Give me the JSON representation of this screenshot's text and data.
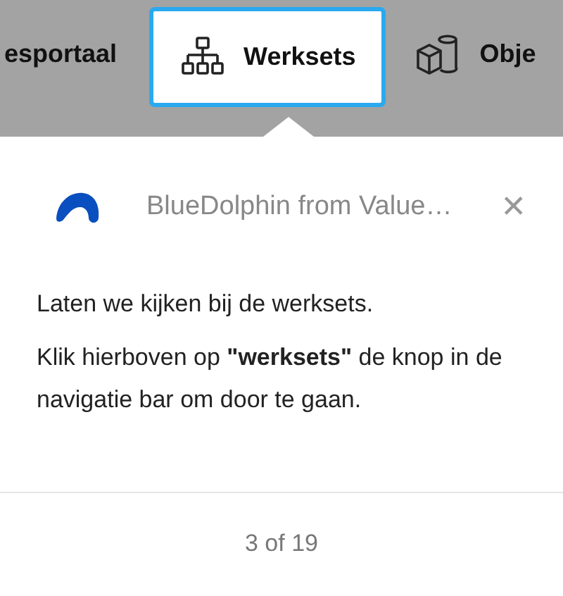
{
  "nav_items": [
    {
      "label": "esportaal",
      "selected": false
    },
    {
      "label": "Werksets",
      "selected": true
    },
    {
      "label": "Obje",
      "selected": false
    }
  ],
  "popup": {
    "title": "BlueDolphin from Value…",
    "close": "✕",
    "paragraphs": [
      "Laten we kijken bij de werksets.",
      "Klik hierboven op **\"werksets\"** de knop in de navigatie bar om door te gaan."
    ],
    "step": "3 of 19"
  }
}
